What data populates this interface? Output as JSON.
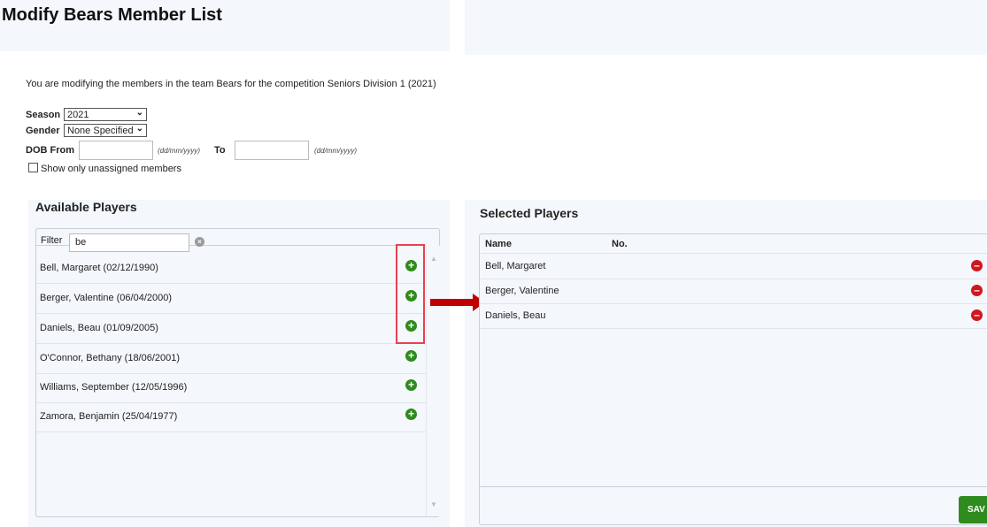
{
  "page": {
    "title": "Modify Bears Member List"
  },
  "intro": "You are modifying the members in the team Bears for the competition Seniors Division 1 (2021)",
  "filters": {
    "season_label": "Season",
    "season_value": "2021",
    "gender_label": "Gender",
    "gender_value": "None Specified",
    "dob_from_label": "DOB From",
    "dob_from_hint": "(dd/mm/yyyy)",
    "dob_to_label": "To",
    "dob_to_hint": "(dd/mm/yyyy)",
    "unassigned_label": "Show only unassigned members"
  },
  "available": {
    "title": "Available Players",
    "filter_label": "Filter",
    "filter_value": "be",
    "players": [
      "Bell, Margaret (02/12/1990)",
      "Berger, Valentine (06/04/2000)",
      "Daniels, Beau (01/09/2005)",
      "O'Connor, Bethany (18/06/2001)",
      "Williams, September (12/05/1996)",
      "Zamora, Benjamin (25/04/1977)"
    ]
  },
  "selected": {
    "title": "Selected Players",
    "col_name": "Name",
    "col_no": "No.",
    "players": [
      "Bell, Margaret",
      "Berger, Valentine",
      "Daniels, Beau"
    ],
    "save_label": "SAV"
  },
  "colors": {
    "add": "#2e8b1d",
    "remove": "#d0181f",
    "highlight": "#e8414f",
    "arrow": "#c00000"
  },
  "icons": [
    "add-circle-icon",
    "remove-circle-icon",
    "clear-filter-icon",
    "arrow-right-icon",
    "scroll-up-icon",
    "scroll-down-icon"
  ]
}
